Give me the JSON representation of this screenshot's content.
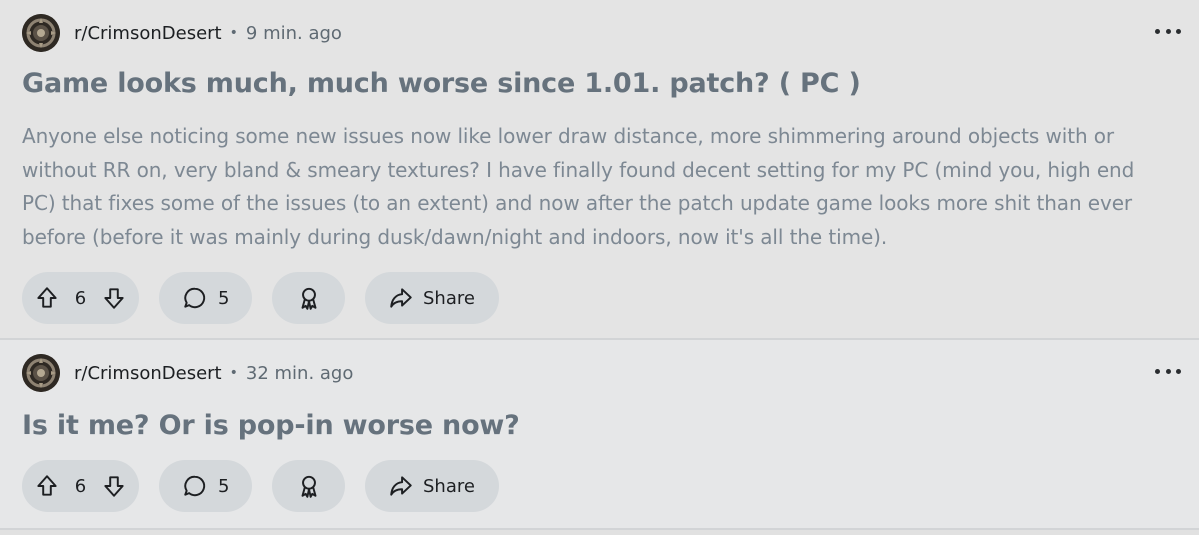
{
  "posts": [
    {
      "subreddit": "r/CrimsonDesert",
      "separator": "•",
      "time": "9 min. ago",
      "title": "Game looks much, much worse since 1.01. patch? ( PC )",
      "body": "Anyone else noticing some new issues now like lower draw distance, more shimmering around objects with or without RR on, very bland & smeary textures? I have finally found decent setting for my PC (mind you, high end PC) that fixes some of the issues (to an extent) and now after the patch update game looks more shit than ever before (before it was mainly during dusk/dawn/night and indoors, now it's all the time).",
      "votes": "6",
      "comments": "5",
      "share_label": "Share"
    },
    {
      "subreddit": "r/CrimsonDesert",
      "separator": "•",
      "time": "32 min. ago",
      "title": "Is it me? Or is pop-in worse now?",
      "votes": "6",
      "comments": "5",
      "share_label": "Share"
    }
  ],
  "icons": {
    "avatar": "crimson-desert-emblem",
    "more": "more-horizontal-icon",
    "upvote": "arrow-up-icon",
    "downvote": "arrow-down-icon",
    "comment": "comment-bubble-icon",
    "award": "award-ribbon-icon",
    "share": "share-arrow-icon"
  },
  "colors": {
    "background": "#e4e4e4",
    "pill": "#d4d8db",
    "title": "#66727d",
    "body_text": "#7d8893"
  }
}
